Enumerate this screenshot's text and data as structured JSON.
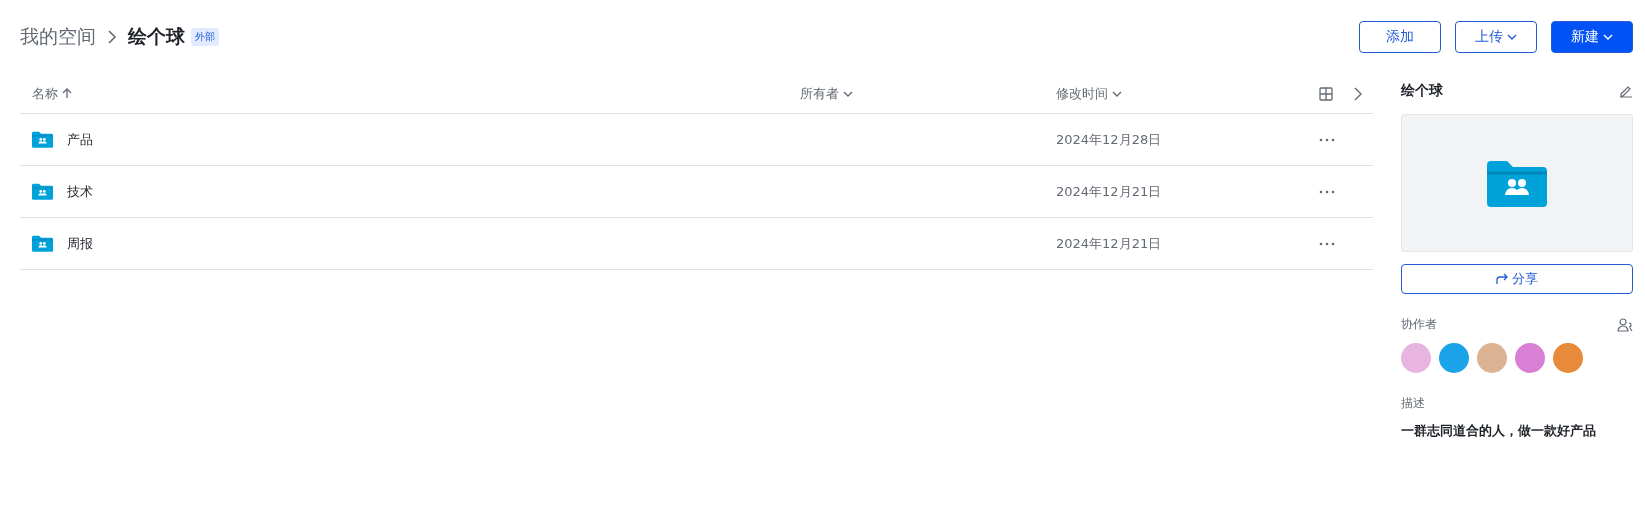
{
  "breadcrumb": {
    "items": [
      "我的空间",
      "绘个球"
    ],
    "badge": "外部"
  },
  "actions": [
    {
      "label": "添加",
      "kind": "outline",
      "dropdown": false
    },
    {
      "label": "上传",
      "kind": "outline",
      "dropdown": true
    },
    {
      "label": "新建",
      "kind": "primary",
      "dropdown": true
    }
  ],
  "table": {
    "columns": [
      {
        "label": "名称",
        "sorted": true
      },
      {
        "label": "所有者",
        "sorted": false
      },
      {
        "label": "修改时间",
        "sorted": false
      }
    ],
    "rows": [
      {
        "name": "产品",
        "modified": "2024年12月28日"
      },
      {
        "name": "技术",
        "modified": "2024年12月21日"
      },
      {
        "name": "周报",
        "modified": "2024年12月21日"
      }
    ]
  },
  "panel": {
    "title": "绘个球",
    "share_label": "分享",
    "collaborators_label": "协作者",
    "collaborators": [
      {
        "color": "#e8b4e0"
      },
      {
        "color": "#1aa3e8"
      },
      {
        "color": "#dcb392"
      },
      {
        "color": "#d97fd6"
      },
      {
        "color": "#e88a3a"
      }
    ],
    "description_label": "描述",
    "description": "一群志同道合的人，做一款好产品"
  }
}
